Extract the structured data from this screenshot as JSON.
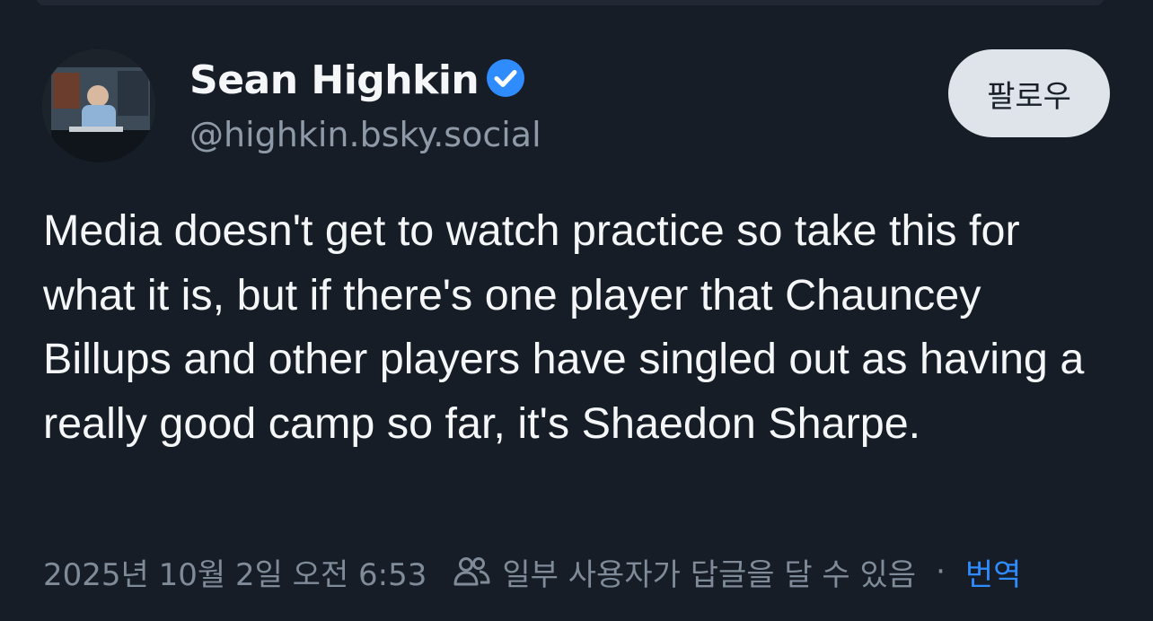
{
  "author": {
    "name": "Sean Highkin",
    "handle": "@highkin.bsky.social",
    "verified": true
  },
  "follow_button": {
    "label": "팔로우"
  },
  "post": {
    "text": "Media doesn't get to watch practice so take this for what it is, but if there's one player that Chauncey Billups and other players have singled out as having a really good camp so far, it's Shaedon Sharpe."
  },
  "meta": {
    "timestamp": "2025년 10월 2일 오전 6:53",
    "reply_restriction": "일부 사용자가 답글을 달 수 있음",
    "separator": "·",
    "translate_label": "번역"
  },
  "icons": {
    "verified": "verified-badge-icon",
    "reply_restriction": "people-icon"
  },
  "colors": {
    "background": "#171d26",
    "accent": "#2f8cff",
    "muted_text": "#7f8b99",
    "follow_button_bg": "#dfe4ea"
  }
}
